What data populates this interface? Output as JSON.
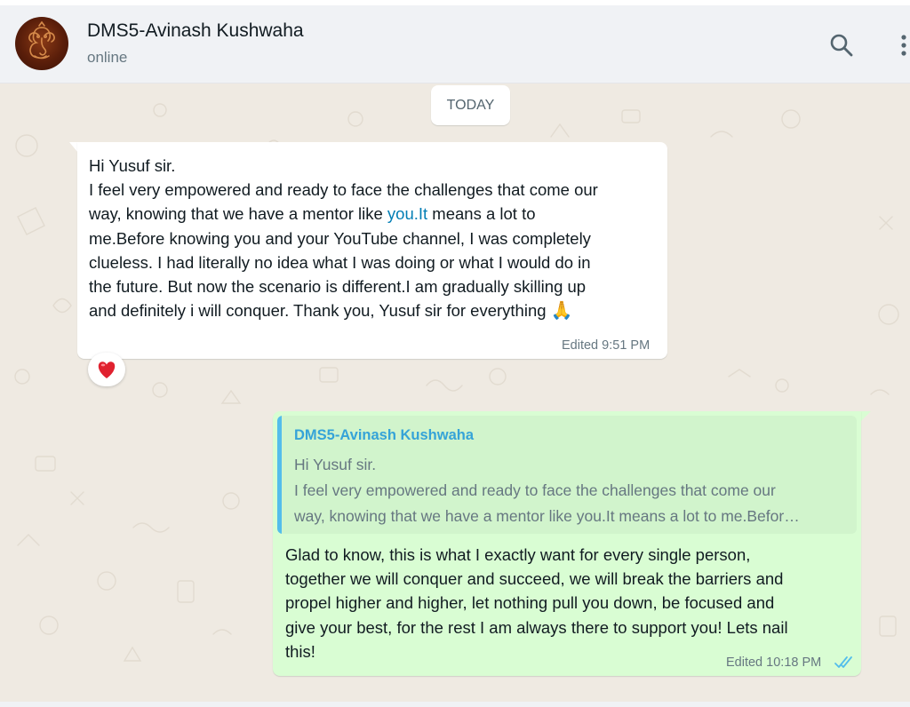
{
  "contact": {
    "name": "DMS5-Avinash Kushwaha",
    "status": "online"
  },
  "chat": {
    "date_label": "TODAY",
    "incoming": {
      "line1": "Hi Yusuf sir.",
      "line2": "I feel very empowered and ready to face the challenges that come our",
      "line3_pre": "way, knowing that we have a mentor like ",
      "line3_link": "you.It",
      "line3_post": " means a lot to",
      "line4": "me.Before knowing you and your YouTube channel, I was completely",
      "line5": "clueless. I had literally no idea what I was doing or what I would do in",
      "line6": "the future. But now the scenario is different.I am gradually skilling up",
      "line7": "and definitely i will conquer. Thank you, Yusuf sir for everything",
      "emoji": "🙏",
      "edited_label": "Edited",
      "time": "9:51 PM",
      "reaction": "❤️"
    },
    "outgoing": {
      "quoted_author": "DMS5-Avinash Kushwaha",
      "quoted_line1": "Hi Yusuf sir.",
      "quoted_line2": "I feel very empowered and ready to face the challenges that come our",
      "quoted_line3": "way, knowing that we have a mentor like you.It means a lot to me.Befor…",
      "line1": "Glad to know, this is what I exactly want for every single person,",
      "line2": "together we will conquer and succeed, we will break the barriers and",
      "line3": "propel higher and higher, let nothing pull you down, be focused and",
      "line4": "give your best, for the rest I am always there to support you! Lets nail",
      "line5": "this!",
      "edited_label": "Edited",
      "time": "10:18 PM",
      "status": "read"
    }
  },
  "colors": {
    "header_bg": "#f0f2f5",
    "chat_bg": "#efeae2",
    "incoming_bubble": "#ffffff",
    "outgoing_bubble": "#d9fdd3",
    "link": "#027eb5",
    "quote_accent": "#53bdeb",
    "read_ticks": "#53bdeb"
  },
  "icons": {
    "search": "search-icon",
    "menu": "more-vertical-icon",
    "read_receipt": "double-check-icon"
  }
}
